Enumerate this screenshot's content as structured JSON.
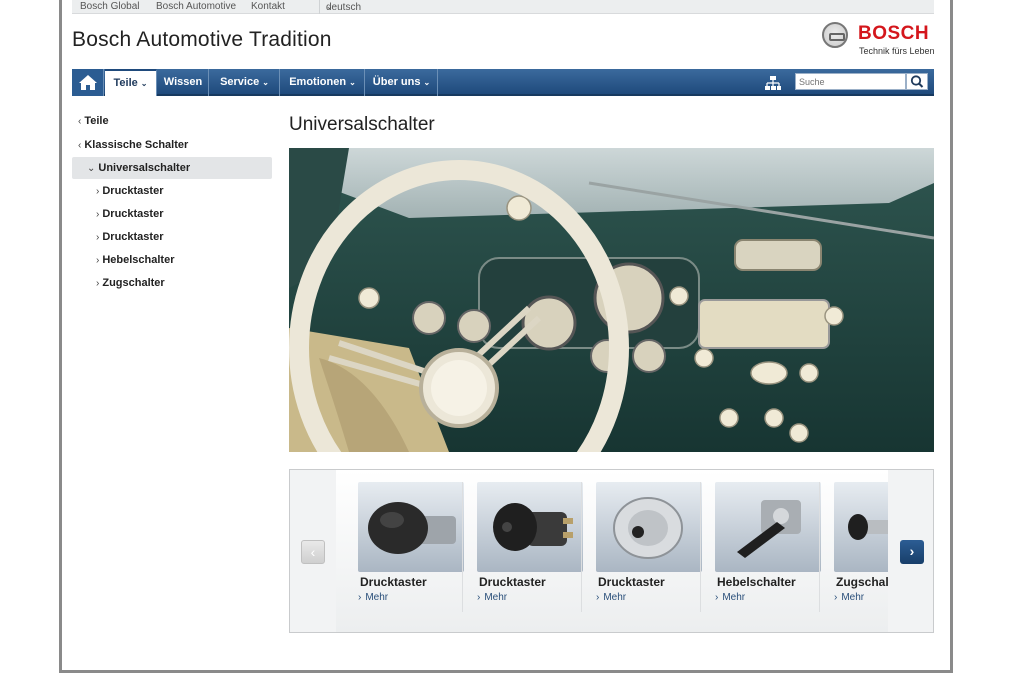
{
  "topbar": {
    "links": [
      "Bosch Global",
      "Bosch Automotive",
      "Kontakt"
    ],
    "language": "deutsch"
  },
  "header": {
    "site_title": "Bosch Automotive Tradition",
    "logo_brand": "BOSCH",
    "logo_claim": "Technik fürs Leben"
  },
  "nav": {
    "items": [
      {
        "label": "Teile",
        "has_menu": true,
        "active": true
      },
      {
        "label": "Wissen",
        "has_menu": false,
        "active": false
      },
      {
        "label": "Service",
        "has_menu": true,
        "active": false
      },
      {
        "label": "Emotionen",
        "has_menu": true,
        "active": false
      },
      {
        "label": "Über uns",
        "has_menu": true,
        "active": false
      }
    ],
    "search_placeholder": "Suche",
    "icons": [
      "home-icon",
      "sitemap-icon",
      "search-icon"
    ]
  },
  "sidebar": {
    "items": [
      {
        "label": "Teile",
        "arrow": "‹"
      },
      {
        "label": "Klassische Schalter",
        "arrow": "‹"
      },
      {
        "label": "Universalschalter",
        "arrow": "⌄"
      },
      {
        "label": "Drucktaster",
        "arrow": "›"
      },
      {
        "label": "Drucktaster",
        "arrow": "›"
      },
      {
        "label": "Drucktaster",
        "arrow": "›"
      },
      {
        "label": "Hebelschalter",
        "arrow": "›"
      },
      {
        "label": "Zugschalter",
        "arrow": "›"
      }
    ]
  },
  "main": {
    "title": "Universalschalter"
  },
  "carousel": {
    "products": [
      {
        "name": "Drucktaster",
        "link": "Mehr"
      },
      {
        "name": "Drucktaster",
        "link": "Mehr"
      },
      {
        "name": "Drucktaster",
        "link": "Mehr"
      },
      {
        "name": "Hebelschalter",
        "link": "Mehr"
      },
      {
        "name": "Zugschalter",
        "link": "Mehr"
      }
    ],
    "prev_symbol": "‹",
    "next_symbol": "›"
  },
  "colors": {
    "nav_blue": "#1f4a7c",
    "brand_red": "#d4161c",
    "link_blue": "#2a4f7a"
  }
}
